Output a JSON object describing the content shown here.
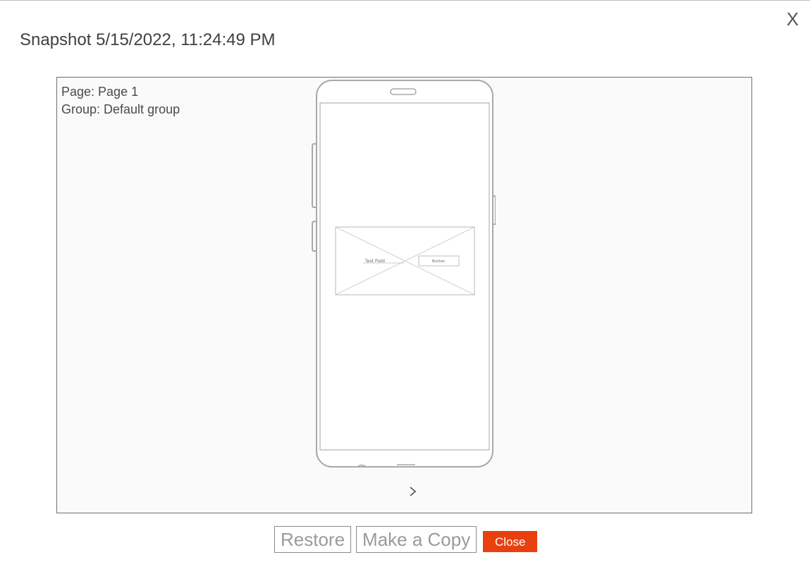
{
  "dialog": {
    "title": "Snapshot 5/15/2022, 11:24:49 PM",
    "close_icon_label": "X"
  },
  "preview": {
    "page_line": "Page: Page 1",
    "group_line": "Group: Default group",
    "mockup": {
      "text_field_label": "Text Field",
      "button_label": "Button"
    },
    "next_icon": "chevron-right-icon"
  },
  "actions": {
    "restore_label": "Restore",
    "copy_label": "Make a Copy",
    "close_label": "Close"
  },
  "colors": {
    "close_button": "#e8400e",
    "preview_border": "#6f6f6f",
    "sketch_stroke": "#a8a8a8"
  }
}
